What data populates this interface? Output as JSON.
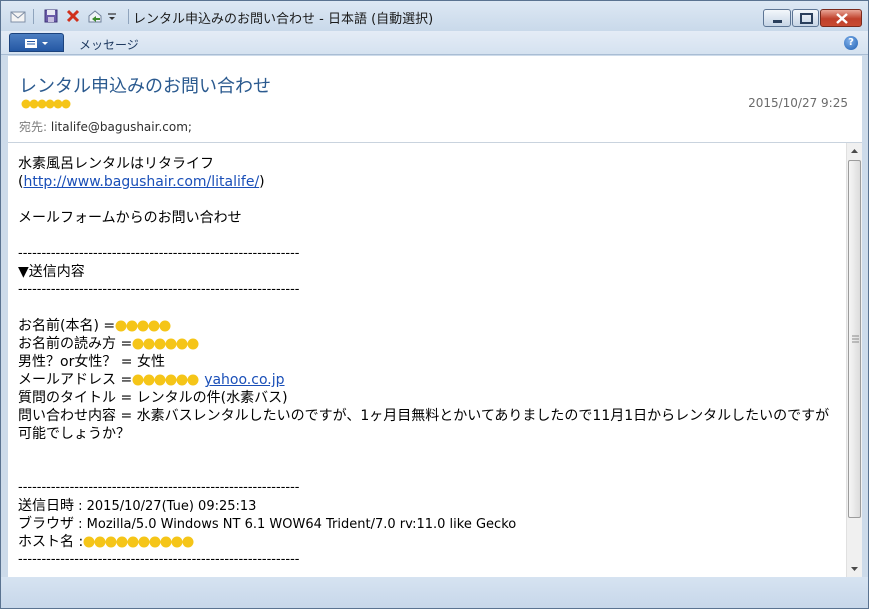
{
  "window": {
    "title": "レンタル申込みのお問い合わせ - 日本語 (自動選択)"
  },
  "toolbar": {
    "icons": [
      "mail-icon",
      "save-icon",
      "delete-icon",
      "reply-icon",
      "dropdown-icon"
    ]
  },
  "ribbon": {
    "tab_message": "メッセージ",
    "help": "?"
  },
  "header": {
    "subject": "レンタル申込みのお問い合わせ",
    "date": "2015/10/27 9:25",
    "to_label": "宛先:",
    "to_value": "litalife@bagushair.com;"
  },
  "body": {
    "shop_name": "水素風呂レンタルはリタライフ",
    "paren_open": "(",
    "shop_url": "http://www.bagushair.com/litalife/",
    "paren_close": ")",
    "form_intro": "メールフォームからのお問い合わせ",
    "separator": "------------------------------------------------------------",
    "section_title": "▼送信内容",
    "name_label": "お名前(本名) =",
    "reading_label": "お名前の読み方 =",
    "gender_line": "男性？or女性？ = 女性",
    "email_label": "メールアドレス =",
    "email_domain": "yahoo.co.jp",
    "subject_line": "質問のタイトル = レンタルの件(水素バス)",
    "inquiry_line": "問い合わせ内容 = 水素バスレンタルしたいのですが、1ヶ月目無料とかいてありましたので11月1日からレンタルしたいのですが可能でしょうか？",
    "sent_label": "送信日時",
    "sent_value": " : 2015/10/27(Tue) 09:25:13",
    "browser_label": "ブラウザ",
    "browser_value": " : Mozilla/5.0 Windows NT 6.1 WOW64 Trident/7.0 rv:11.0 like Gecko",
    "host_label": "ホスト名 :"
  },
  "colors": {
    "subject": "#2b5a8f",
    "link": "#1a4fb8",
    "mosaic": "#f5c518"
  }
}
